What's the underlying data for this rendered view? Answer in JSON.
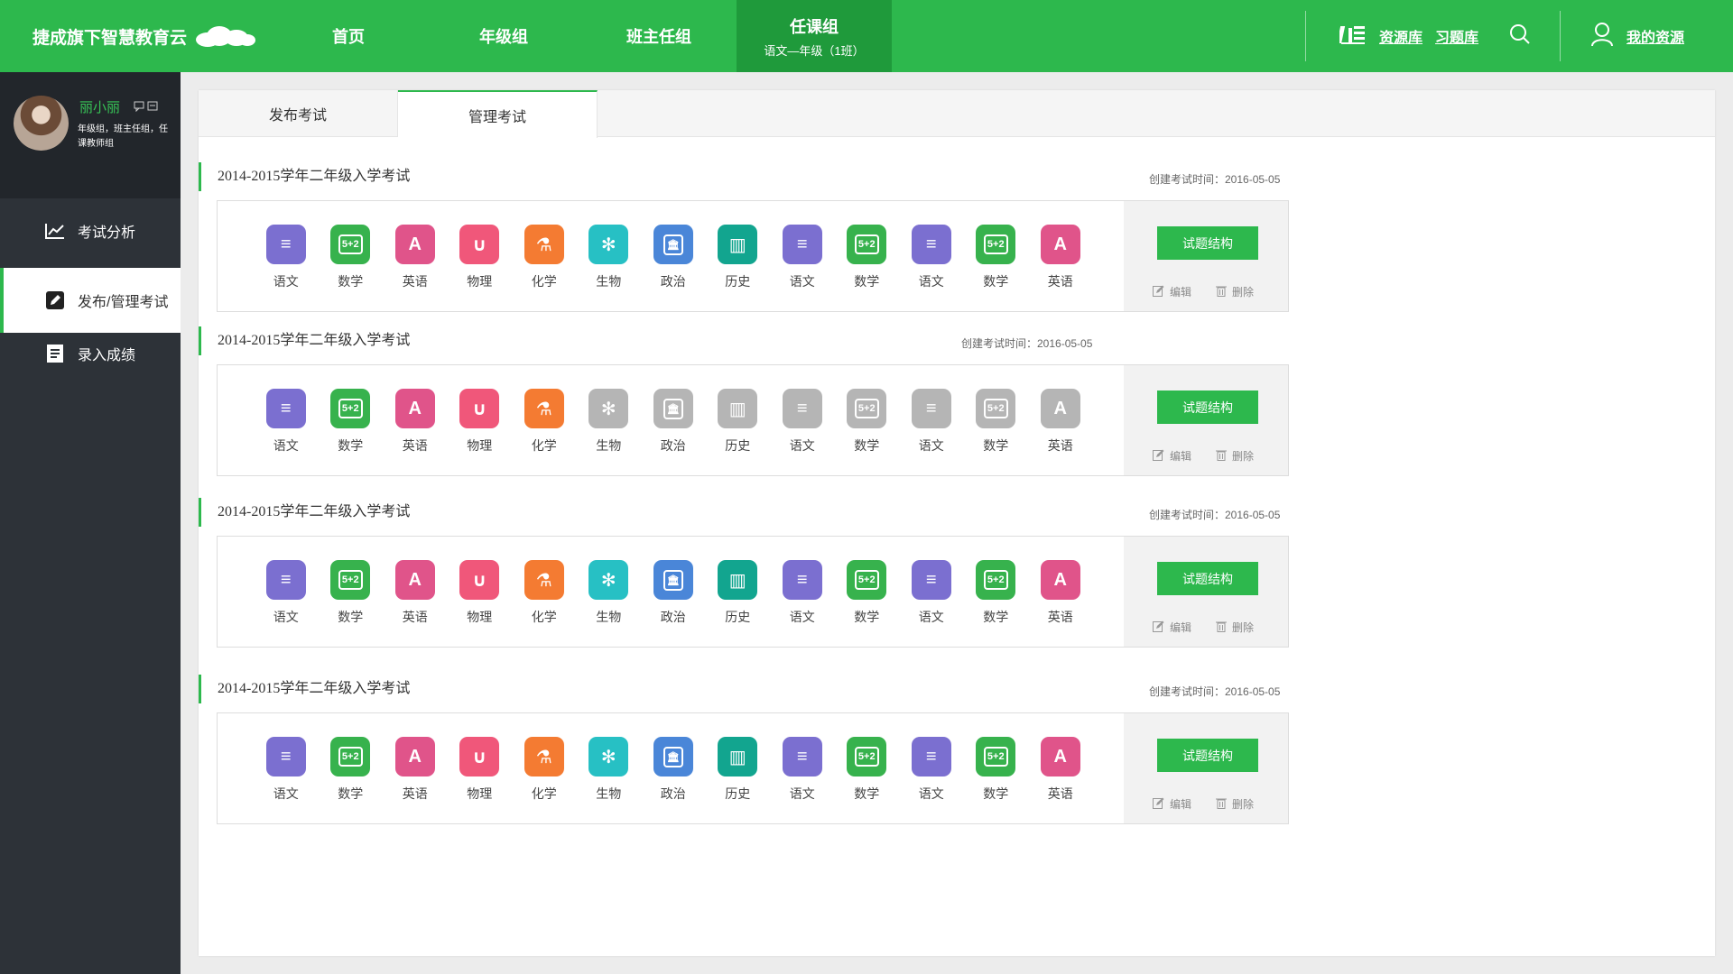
{
  "header": {
    "logo": "捷成旗下智慧教育云",
    "nav": [
      {
        "label": "首页",
        "sub": ""
      },
      {
        "label": "年级组",
        "sub": ""
      },
      {
        "label": "班主任组",
        "sub": ""
      },
      {
        "label": "任课组",
        "sub": "语文—年级（1班）"
      }
    ],
    "resources": "资源库",
    "exercises": "习题库",
    "my_resources": "我的资源"
  },
  "sidebar": {
    "user": {
      "name": "丽小丽",
      "role": "年级组，班主任组，任课教师组"
    },
    "items": [
      {
        "label": "考试分析",
        "icon": "chart-line-icon"
      },
      {
        "label": "发布/管理考试",
        "icon": "edit-icon"
      },
      {
        "label": "录入成绩",
        "icon": "document-icon"
      }
    ]
  },
  "tabs": [
    "发布考试",
    "管理考试"
  ],
  "subjects": [
    {
      "label": "语文",
      "icon": "book-stack-icon",
      "color": "#7b6fd0",
      "glyph": "≡"
    },
    {
      "label": "数学",
      "icon": "calculator-icon",
      "color": "#37b24d",
      "glyph": "5+2"
    },
    {
      "label": "英语",
      "icon": "letter-a-icon",
      "color": "#e0548a",
      "glyph": "A"
    },
    {
      "label": "物理",
      "icon": "magnet-icon",
      "color": "#f0577a",
      "glyph": "∪"
    },
    {
      "label": "化学",
      "icon": "flask-icon",
      "color": "#f47b32",
      "glyph": "⚗"
    },
    {
      "label": "生物",
      "icon": "molecule-icon",
      "color": "#27c0c4",
      "glyph": "✻"
    },
    {
      "label": "政治",
      "icon": "government-icon",
      "color": "#4a86d8",
      "glyph": "🏛"
    },
    {
      "label": "历史",
      "icon": "scroll-icon",
      "color": "#12a58f",
      "glyph": "▥"
    },
    {
      "label": "语文",
      "icon": "book-stack-icon",
      "color": "#7b6fd0",
      "glyph": "≡"
    },
    {
      "label": "数学",
      "icon": "calculator-icon",
      "color": "#37b24d",
      "glyph": "5+2"
    },
    {
      "label": "语文",
      "icon": "book-stack-icon",
      "color": "#7b6fd0",
      "glyph": "≡"
    },
    {
      "label": "数学",
      "icon": "calculator-icon",
      "color": "#37b24d",
      "glyph": "5+2"
    },
    {
      "label": "英语",
      "icon": "letter-a-icon",
      "color": "#e0548a",
      "glyph": "A"
    }
  ],
  "exams": [
    {
      "title": "2014-2015学年二年级入学考试",
      "date": "创建考试时间：2016-05-05",
      "active_count": 13
    },
    {
      "title": "2014-2015学年二年级入学考试",
      "date": "创建考试时间：2016-05-05",
      "active_count": 5
    },
    {
      "title": "2014-2015学年二年级入学考试",
      "date": "创建考试时间：2016-05-05",
      "active_count": 13
    },
    {
      "title": "2014-2015学年二年级入学考试",
      "date": "创建考试时间：2016-05-05",
      "active_count": 13
    }
  ],
  "actions": {
    "structure": "试题结构",
    "edit": "编辑",
    "delete": "删除"
  },
  "colors": {
    "brand": "#2db84d",
    "brand_dark": "#1f9a3b",
    "sidebar": "#2d3238",
    "disabled": "#b5b5b5"
  }
}
